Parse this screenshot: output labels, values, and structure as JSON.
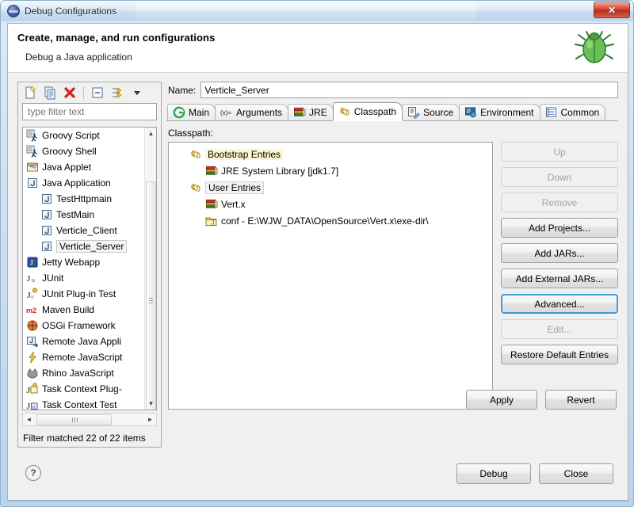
{
  "window": {
    "title": "Debug Configurations",
    "title_icon": "eclipse-sphere-icon",
    "close_label": "✕"
  },
  "header": {
    "title": "Create, manage, and run configurations",
    "subtitle": "Debug a Java application",
    "banner_icon": "green-bug-icon"
  },
  "left_panel": {
    "toolbar": [
      {
        "name": "new-launch-configuration-icon",
        "label": "New"
      },
      {
        "name": "duplicate-configuration-icon",
        "label": "Duplicate"
      },
      {
        "name": "delete-configuration-icon",
        "label": "Delete"
      },
      {
        "name": "collapse-all-icon",
        "label": "Collapse All"
      },
      {
        "name": "filter-icon",
        "label": "Filter"
      },
      {
        "name": "chevron-down-icon",
        "label": "Menu"
      }
    ],
    "filter": {
      "placeholder": "type filter text",
      "value": ""
    },
    "tree": [
      {
        "label": "Groovy Script",
        "icon": "groovy-script-icon",
        "level": 0,
        "selected": false
      },
      {
        "label": "Groovy Shell",
        "icon": "groovy-shell-icon",
        "level": 0,
        "selected": false
      },
      {
        "label": "Java Applet",
        "icon": "java-applet-icon",
        "level": 0,
        "selected": false
      },
      {
        "label": "Java Application",
        "icon": "java-application-icon",
        "level": 0,
        "selected": false
      },
      {
        "label": "TestHttpmain",
        "icon": "java-launch-icon",
        "level": 1,
        "selected": false
      },
      {
        "label": "TestMain",
        "icon": "java-launch-icon",
        "level": 1,
        "selected": false
      },
      {
        "label": "Verticle_Client",
        "icon": "java-launch-icon",
        "level": 1,
        "selected": false
      },
      {
        "label": "Verticle_Server",
        "icon": "java-launch-icon",
        "level": 1,
        "selected": true
      },
      {
        "label": "Jetty Webapp",
        "icon": "jetty-icon",
        "level": 0,
        "selected": false
      },
      {
        "label": "JUnit",
        "icon": "junit-icon",
        "level": 0,
        "selected": false
      },
      {
        "label": "JUnit Plug-in Test",
        "icon": "junit-plugin-icon",
        "level": 0,
        "selected": false
      },
      {
        "label": "Maven Build",
        "icon": "maven-icon",
        "level": 0,
        "selected": false
      },
      {
        "label": "OSGi Framework",
        "icon": "osgi-icon",
        "level": 0,
        "selected": false
      },
      {
        "label": "Remote Java Appli",
        "icon": "remote-java-icon",
        "level": 0,
        "selected": false
      },
      {
        "label": "Remote JavaScript",
        "icon": "remote-javascript-icon",
        "level": 0,
        "selected": false
      },
      {
        "label": "Rhino JavaScript",
        "icon": "rhino-icon",
        "level": 0,
        "selected": false
      },
      {
        "label": "Task Context Plug-",
        "icon": "task-context-plugin-icon",
        "level": 0,
        "selected": false
      },
      {
        "label": "Task Context Test",
        "icon": "task-context-test-icon",
        "level": 0,
        "selected": false
      }
    ],
    "status": "Filter matched 22 of 22 items"
  },
  "right_panel": {
    "name_label": "Name:",
    "name_value": "Verticle_Server",
    "tabs": [
      {
        "label": "Main",
        "icon": "main-tab-icon",
        "active": false
      },
      {
        "label": "Arguments",
        "icon": "arguments-tab-icon",
        "active": false
      },
      {
        "label": "JRE",
        "icon": "jre-tab-icon",
        "active": false
      },
      {
        "label": "Classpath",
        "icon": "classpath-tab-icon",
        "active": true
      },
      {
        "label": "Source",
        "icon": "source-tab-icon",
        "active": false
      },
      {
        "label": "Environment",
        "icon": "environment-tab-icon",
        "active": false
      },
      {
        "label": "Common",
        "icon": "common-tab-icon",
        "active": false
      }
    ],
    "classpath_label": "Classpath:",
    "classpath_tree": [
      {
        "label": "Bootstrap Entries",
        "icon": "classpath-group-icon",
        "level": 0,
        "highlight": "yellow"
      },
      {
        "label": "JRE System Library [jdk1.7]",
        "icon": "library-icon",
        "level": 1,
        "highlight": "none"
      },
      {
        "label": "User Entries",
        "icon": "classpath-group-icon",
        "level": 0,
        "highlight": "grey"
      },
      {
        "label": "Vert.x",
        "icon": "library-icon",
        "level": 1,
        "highlight": "none"
      },
      {
        "label": "conf - E:\\WJW_DATA\\OpenSource\\Vert.x\\exe-dir\\",
        "icon": "folder-icon",
        "level": 1,
        "highlight": "none"
      }
    ],
    "side_buttons": [
      {
        "label": "Up",
        "state": "disabled"
      },
      {
        "label": "Down",
        "state": "disabled"
      },
      {
        "label": "Remove",
        "state": "disabled"
      },
      {
        "label": "Add Projects...",
        "state": "enabled"
      },
      {
        "label": "Add JARs...",
        "state": "enabled"
      },
      {
        "label": "Add External JARs...",
        "state": "enabled"
      },
      {
        "label": "Advanced...",
        "state": "focused"
      },
      {
        "label": "Edit...",
        "state": "disabled"
      },
      {
        "label": "Restore Default Entries",
        "state": "enabled"
      }
    ],
    "apply_label": "Apply",
    "revert_label": "Revert"
  },
  "footer": {
    "help_icon": "help-question-icon",
    "help_glyph": "?",
    "debug_label": "Debug",
    "close_label": "Close"
  },
  "colors": {
    "accent_focus": "#3c9fd6",
    "title_bar": "#bcd6ee",
    "dialog_bg": "#f0f0f0",
    "highlight_yellow": "#fcf7d3",
    "close_red": "#d9503b"
  }
}
